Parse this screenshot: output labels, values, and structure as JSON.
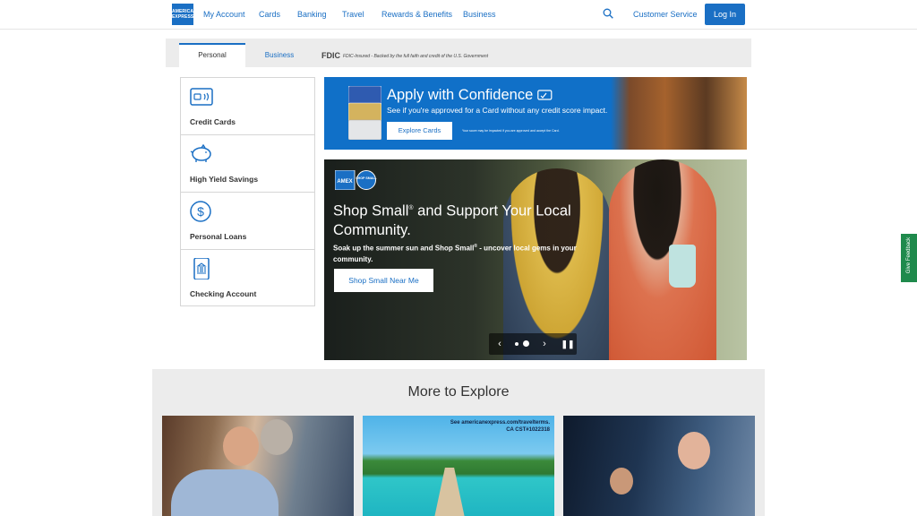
{
  "header": {
    "logo_text": "AMERICAN EXPRESS",
    "nav": [
      "My Account",
      "Cards",
      "Banking",
      "Travel",
      "Rewards & Benefits",
      "Business"
    ],
    "customer_service": "Customer Service",
    "login": "Log In"
  },
  "tabs": {
    "items": [
      "Personal",
      "Business"
    ],
    "active": "Personal",
    "fdic_logo": "FDIC",
    "fdic_text": "FDIC-Insured - Backed by the full faith and credit of the U.S. Government"
  },
  "products": [
    {
      "label": "Credit Cards",
      "icon": "credit-card-icon"
    },
    {
      "label": "High Yield Savings",
      "icon": "piggy-bank-icon"
    },
    {
      "label": "Personal Loans",
      "icon": "dollar-circle-icon"
    },
    {
      "label": "Checking Account",
      "icon": "bank-phone-icon"
    }
  ],
  "apply_banner": {
    "title": "Apply with Confidence",
    "subtitle": "See if you're approved for a Card without any credit score impact.",
    "button": "Explore Cards",
    "fine_print": "Your score may be impacted if you are approved and accept the Card."
  },
  "hero": {
    "title_part1": "Shop Small",
    "title_sup": "®",
    "title_part2": " and Support Your Local Community.",
    "copy_part1": "Soak up the summer sun and Shop Small",
    "copy_sup": "®",
    "copy_part2": " - uncover local gems in your community.",
    "button": "Shop Small Near Me",
    "badge_amex": "AMEX",
    "badge_shop": "SHOP SMALL",
    "carousel_slide": 2,
    "carousel_total": 2
  },
  "explore": {
    "title": "More to Explore",
    "travel_fine_print_1": "See americanexpress.com/travelterms.",
    "travel_fine_print_2": "CA CST#1022318"
  },
  "feedback": "Give Feedback",
  "colors": {
    "brand_blue": "#1a6fc4",
    "banner_blue": "#1070c8",
    "feedback_green": "#1f8a4c"
  }
}
